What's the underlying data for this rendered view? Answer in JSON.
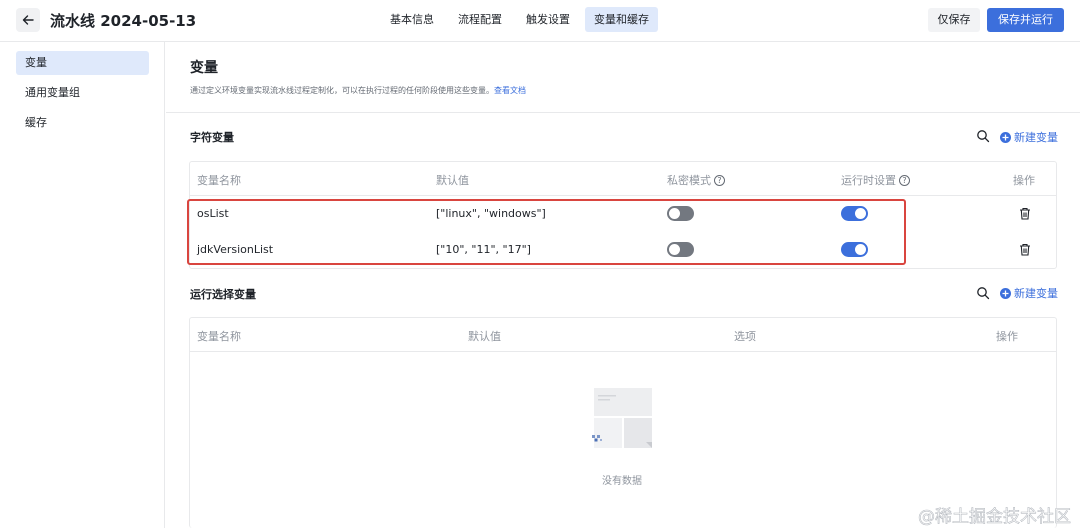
{
  "header": {
    "title": "流水线 2024-05-13",
    "tabs": [
      {
        "label": "基本信息"
      },
      {
        "label": "流程配置"
      },
      {
        "label": "触发设置"
      },
      {
        "label": "变量和缓存",
        "active": true
      }
    ],
    "save_draft_label": "仅保存",
    "save_run_label": "保存并运行",
    "accent_color": "#3c6fdc"
  },
  "sidebar": {
    "items": [
      {
        "label": "变量",
        "active": true
      },
      {
        "label": "通用变量组"
      },
      {
        "label": "缓存"
      }
    ]
  },
  "page": {
    "title": "变量",
    "description": "通过定义环境变量实现流水线过程定制化，可以在执行过程的任何阶段使用这些变量。",
    "doc_link": "查看文档"
  },
  "string_vars": {
    "title": "字符变量",
    "new_label": "新建变量",
    "columns": [
      "变量名称",
      "默认值",
      "私密模式",
      "运行时设置",
      "操作"
    ],
    "rows": [
      {
        "name": "osList",
        "default": "[\"linux\", \"windows\"]",
        "secret": false,
        "runtime": true
      },
      {
        "name": "jdkVersionList",
        "default": "[\"10\", \"11\", \"17\"]",
        "secret": false,
        "runtime": true
      }
    ]
  },
  "select_vars": {
    "title": "运行选择变量",
    "new_label": "新建变量",
    "columns": [
      "变量名称",
      "默认值",
      "选项",
      "操作"
    ],
    "empty_text": "没有数据"
  },
  "watermark": "@稀土掘金技术社区"
}
